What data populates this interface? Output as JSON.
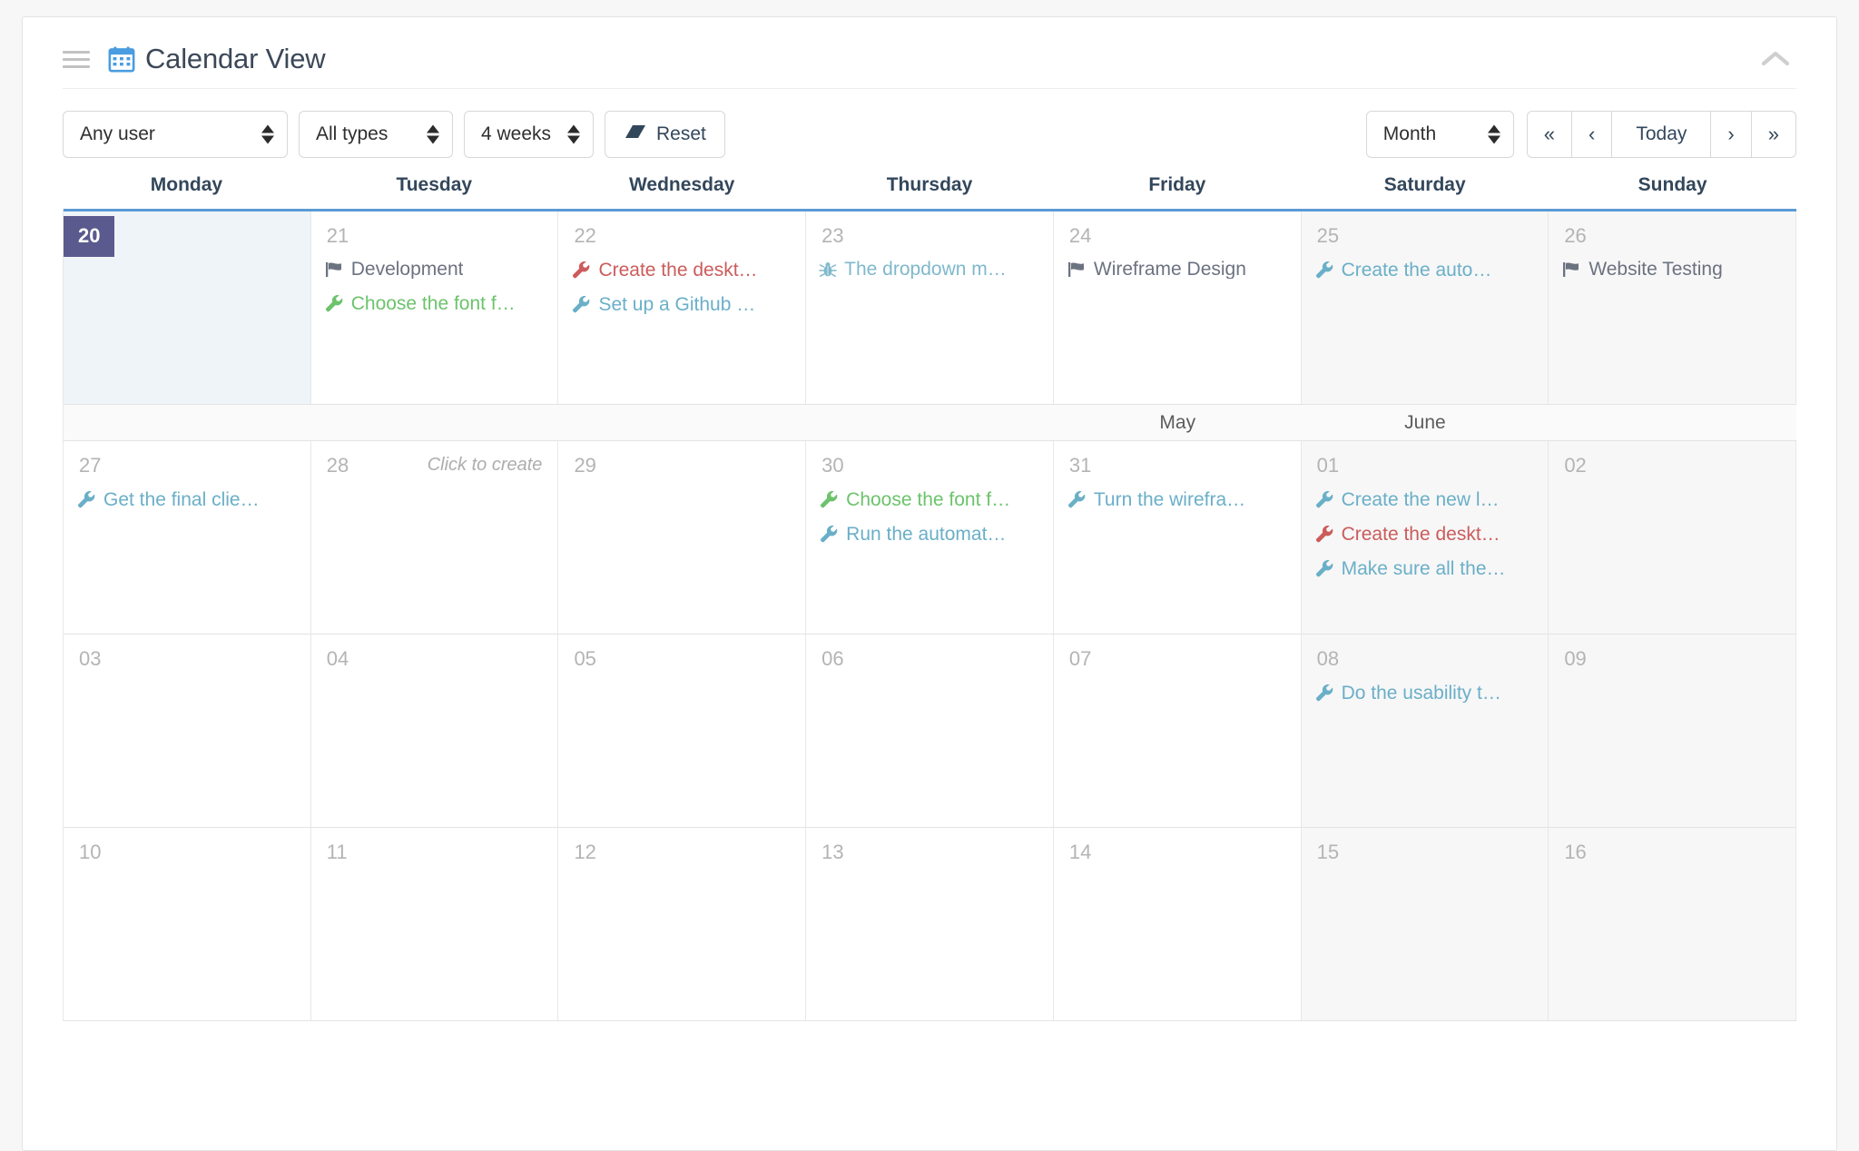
{
  "header": {
    "title": "Calendar View",
    "drag_handle_icon": "hamburger-drag-icon",
    "calendar_icon": "calendar-icon",
    "collapse_icon": "chevron-up-icon"
  },
  "toolbar": {
    "user_filter": "Any user",
    "type_filter": "All types",
    "span_filter": "4 weeks",
    "reset_label": "Reset",
    "reset_icon": "eraser-icon",
    "view_mode": "Month",
    "nav": {
      "first": "«",
      "prev": "‹",
      "today": "Today",
      "next": "›",
      "last": "»"
    }
  },
  "colors": {
    "accent_blue": "#5a9bd5",
    "today_badge": "#5a5a8f",
    "event_blue": "#6aafc8",
    "event_green": "#6cc36c",
    "event_red": "#cc5b5b",
    "milestone_gray": "#6b7280",
    "bug_blue": "#7fb8cc"
  },
  "weekdays": [
    "Monday",
    "Tuesday",
    "Wednesday",
    "Thursday",
    "Friday",
    "Saturday",
    "Sunday"
  ],
  "month_divider": {
    "cells": [
      "",
      "",
      "",
      "",
      "May",
      "June",
      ""
    ]
  },
  "weeks": [
    {
      "is_today_week": true,
      "days": [
        {
          "num": "20",
          "is_today": true,
          "weekend": false,
          "hint": "",
          "events": []
        },
        {
          "num": "21",
          "is_today": false,
          "weekend": false,
          "hint": "",
          "events": [
            {
              "icon": "flag-icon",
              "color": "milestone_gray",
              "text": "Development"
            },
            {
              "icon": "wrench-icon",
              "color": "event_green",
              "text": "Choose the font f…"
            }
          ]
        },
        {
          "num": "22",
          "is_today": false,
          "weekend": false,
          "hint": "",
          "events": [
            {
              "icon": "wrench-icon",
              "color": "event_red",
              "text": "Create the deskt…"
            },
            {
              "icon": "wrench-icon",
              "color": "event_blue",
              "text": "Set up a Github …"
            }
          ]
        },
        {
          "num": "23",
          "is_today": false,
          "weekend": false,
          "hint": "",
          "events": [
            {
              "icon": "bug-icon",
              "color": "bug_blue",
              "text": "The dropdown m…"
            }
          ]
        },
        {
          "num": "24",
          "is_today": false,
          "weekend": false,
          "hint": "",
          "events": [
            {
              "icon": "flag-icon",
              "color": "milestone_gray",
              "text": "Wireframe Design"
            }
          ]
        },
        {
          "num": "25",
          "is_today": false,
          "weekend": true,
          "hint": "",
          "events": [
            {
              "icon": "wrench-icon",
              "color": "event_blue",
              "text": "Create the auto…"
            }
          ]
        },
        {
          "num": "26",
          "is_today": false,
          "weekend": true,
          "hint": "",
          "events": [
            {
              "icon": "flag-icon",
              "color": "milestone_gray",
              "text": "Website Testing"
            }
          ]
        }
      ]
    },
    {
      "is_today_week": false,
      "days": [
        {
          "num": "27",
          "is_today": false,
          "weekend": false,
          "hint": "",
          "events": [
            {
              "icon": "wrench-icon",
              "color": "event_blue",
              "text": "Get the final clie…"
            }
          ]
        },
        {
          "num": "28",
          "is_today": false,
          "weekend": false,
          "hint": "Click to create",
          "events": []
        },
        {
          "num": "29",
          "is_today": false,
          "weekend": false,
          "hint": "",
          "events": []
        },
        {
          "num": "30",
          "is_today": false,
          "weekend": false,
          "hint": "",
          "events": [
            {
              "icon": "wrench-icon",
              "color": "event_green",
              "text": "Choose the font f…"
            },
            {
              "icon": "wrench-icon",
              "color": "event_blue",
              "text": "Run the automat…"
            }
          ]
        },
        {
          "num": "31",
          "is_today": false,
          "weekend": false,
          "hint": "",
          "events": [
            {
              "icon": "wrench-icon",
              "color": "event_blue",
              "text": "Turn the wirefra…"
            }
          ]
        },
        {
          "num": "01",
          "is_today": false,
          "weekend": true,
          "hint": "",
          "events": [
            {
              "icon": "wrench-icon",
              "color": "event_blue",
              "text": "Create the new l…"
            },
            {
              "icon": "wrench-icon",
              "color": "event_red",
              "text": "Create the deskt…"
            },
            {
              "icon": "wrench-icon",
              "color": "event_blue",
              "text": "Make sure all the…"
            }
          ]
        },
        {
          "num": "02",
          "is_today": false,
          "weekend": true,
          "hint": "",
          "events": []
        }
      ]
    },
    {
      "is_today_week": false,
      "days": [
        {
          "num": "03",
          "is_today": false,
          "weekend": false,
          "hint": "",
          "events": []
        },
        {
          "num": "04",
          "is_today": false,
          "weekend": false,
          "hint": "",
          "events": []
        },
        {
          "num": "05",
          "is_today": false,
          "weekend": false,
          "hint": "",
          "events": []
        },
        {
          "num": "06",
          "is_today": false,
          "weekend": false,
          "hint": "",
          "events": []
        },
        {
          "num": "07",
          "is_today": false,
          "weekend": false,
          "hint": "",
          "events": []
        },
        {
          "num": "08",
          "is_today": false,
          "weekend": true,
          "hint": "",
          "events": [
            {
              "icon": "wrench-icon",
              "color": "event_blue",
              "text": "Do the usability t…"
            }
          ]
        },
        {
          "num": "09",
          "is_today": false,
          "weekend": true,
          "hint": "",
          "events": []
        }
      ]
    },
    {
      "is_today_week": false,
      "days": [
        {
          "num": "10",
          "is_today": false,
          "weekend": false,
          "hint": "",
          "events": []
        },
        {
          "num": "11",
          "is_today": false,
          "weekend": false,
          "hint": "",
          "events": []
        },
        {
          "num": "12",
          "is_today": false,
          "weekend": false,
          "hint": "",
          "events": []
        },
        {
          "num": "13",
          "is_today": false,
          "weekend": false,
          "hint": "",
          "events": []
        },
        {
          "num": "14",
          "is_today": false,
          "weekend": false,
          "hint": "",
          "events": []
        },
        {
          "num": "15",
          "is_today": false,
          "weekend": true,
          "hint": "",
          "events": []
        },
        {
          "num": "16",
          "is_today": false,
          "weekend": true,
          "hint": "",
          "events": []
        }
      ]
    }
  ]
}
